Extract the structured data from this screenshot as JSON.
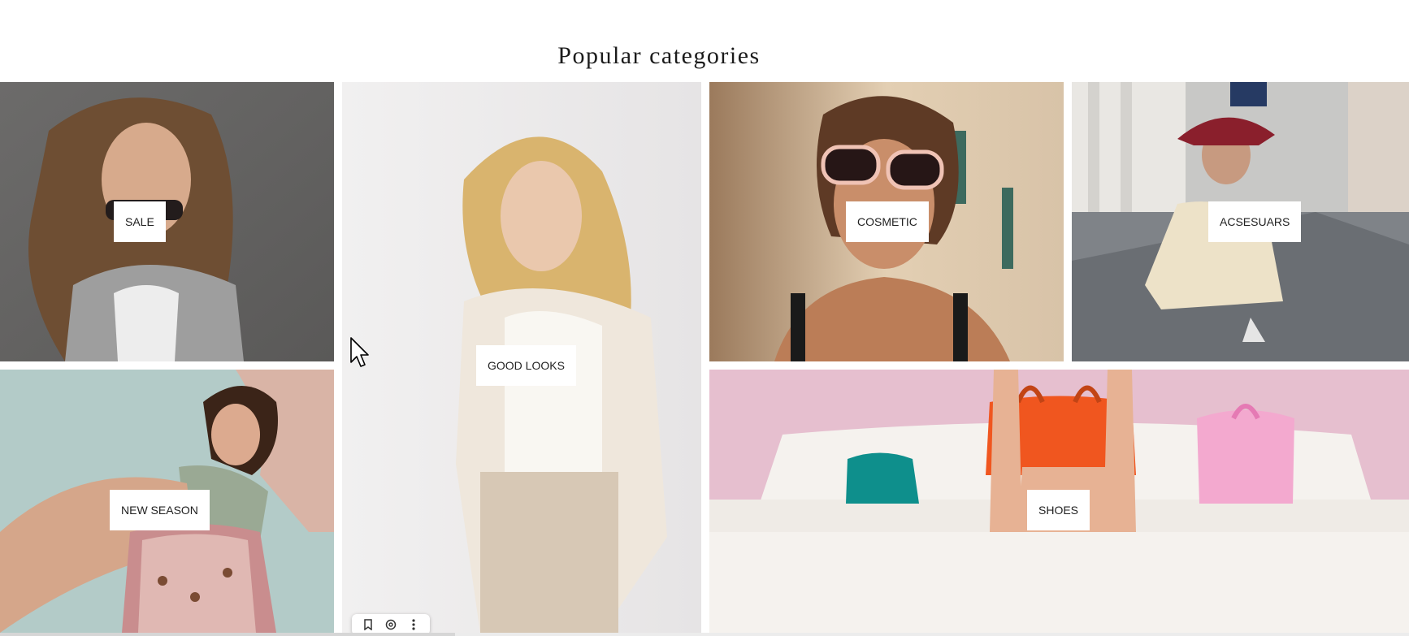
{
  "section": {
    "title": "Popular categories"
  },
  "categories": [
    {
      "label": "SALE"
    },
    {
      "label": "GOOD LOOKS"
    },
    {
      "label": "COSMETIC"
    },
    {
      "label": "ACSESUARS"
    },
    {
      "label": "NEW SEASON"
    },
    {
      "label": "SHOES"
    }
  ],
  "image_toolbar": {
    "icons": [
      "bookmark-icon",
      "visual-search-icon",
      "more-vertical-icon"
    ]
  },
  "colors": {
    "label_bg": "#ffffff",
    "label_text": "#222222",
    "title_text": "#1b1b1b"
  }
}
